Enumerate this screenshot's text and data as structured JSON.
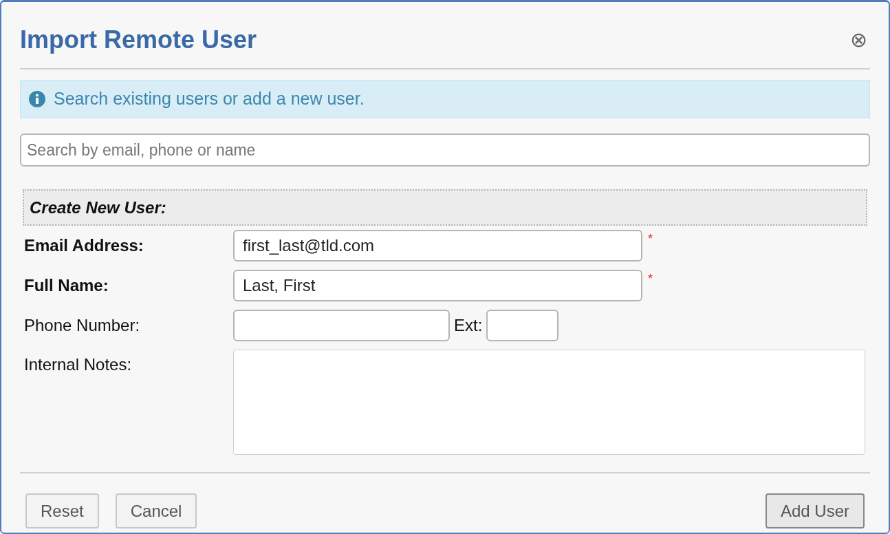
{
  "dialog": {
    "title": "Import Remote User",
    "close_icon": "⊗"
  },
  "info": {
    "text": "Search existing users or add a new user."
  },
  "search": {
    "placeholder": "Search by email, phone or name"
  },
  "section": {
    "title": "Create New User:"
  },
  "fields": [
    {
      "kind": "text",
      "label": "Email Address:",
      "value": "first_last@tld.com",
      "required": true,
      "marker": "*"
    },
    {
      "kind": "text",
      "label": "Full Name:",
      "value": "Last, First",
      "required": true,
      "marker": "*"
    },
    {
      "kind": "phone",
      "label": "Phone Number:",
      "required": false,
      "ext_label": "Ext:"
    },
    {
      "kind": "textarea",
      "label": "Internal Notes:",
      "required": false
    }
  ],
  "buttons": [
    {
      "label": "Reset",
      "primary": false
    },
    {
      "label": "Cancel",
      "primary": false
    },
    {
      "label": "Add User",
      "primary": true
    }
  ]
}
